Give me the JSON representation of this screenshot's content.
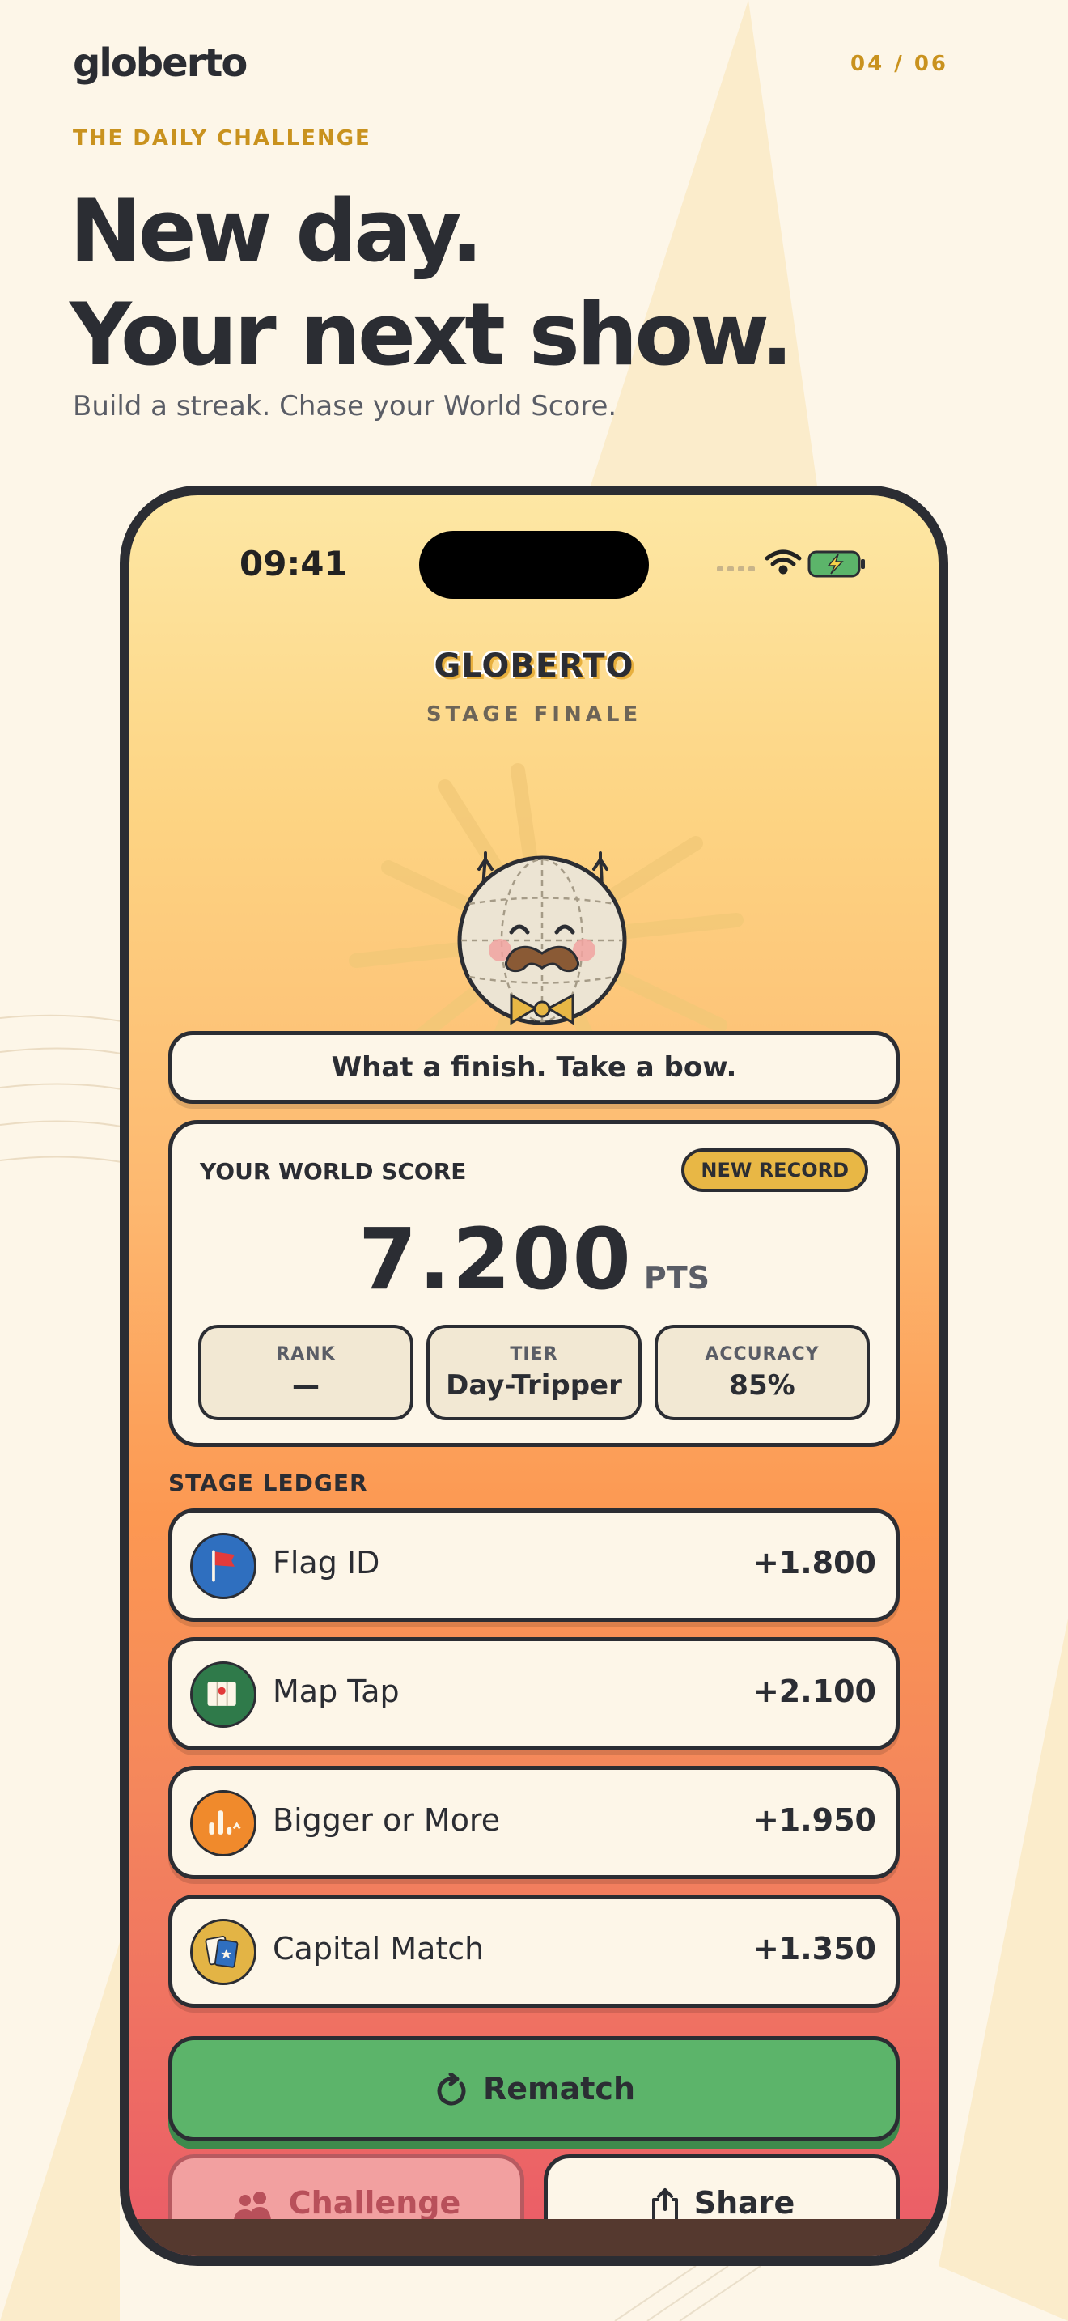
{
  "header": {
    "brand": "globerto",
    "pager": "04 / 06",
    "eyebrow": "THE DAILY CHALLENGE",
    "headline_line1": "New day.",
    "headline_line2": "Your next show.",
    "subtitle": "Build a streak. Chase your World Score."
  },
  "status_bar": {
    "time": "09:41",
    "icons": [
      "signal-icon",
      "wifi-icon",
      "battery-charging-icon"
    ]
  },
  "stage": {
    "title": "GLOBERTO",
    "subtitle": "STAGE FINALE",
    "mascot": "globe-mascot-icon",
    "message": "What a finish. Take a bow."
  },
  "score": {
    "label": "YOUR WORLD SCORE",
    "badge": "NEW RECORD",
    "value": "7.200",
    "unit": "PTS",
    "stats": [
      {
        "label": "RANK",
        "value": "—"
      },
      {
        "label": "TIER",
        "value": "Day-Tripper"
      },
      {
        "label": "ACCURACY",
        "value": "85%"
      }
    ]
  },
  "ledger": {
    "title": "STAGE LEDGER",
    "rows": [
      {
        "label": "Flag ID",
        "points": "+1.800",
        "icon": "flag-icon",
        "color": "#2f6fbf"
      },
      {
        "label": "Map Tap",
        "points": "+2.100",
        "icon": "map-icon",
        "color": "#2f7a4a"
      },
      {
        "label": "Bigger or More",
        "points": "+1.950",
        "icon": "bar-chart-icon",
        "color": "#f08a2c"
      },
      {
        "label": "Capital Match",
        "points": "+1.350",
        "icon": "capital-card-icon",
        "color": "#e3b445"
      }
    ]
  },
  "actions": {
    "rematch": "Rematch",
    "challenge": "Challenge",
    "share": "Share"
  },
  "colors": {
    "accent": "#c9921e",
    "rematch": "#5cb46a",
    "challenge": "#f2a0a0",
    "badge": "#e8b745"
  }
}
